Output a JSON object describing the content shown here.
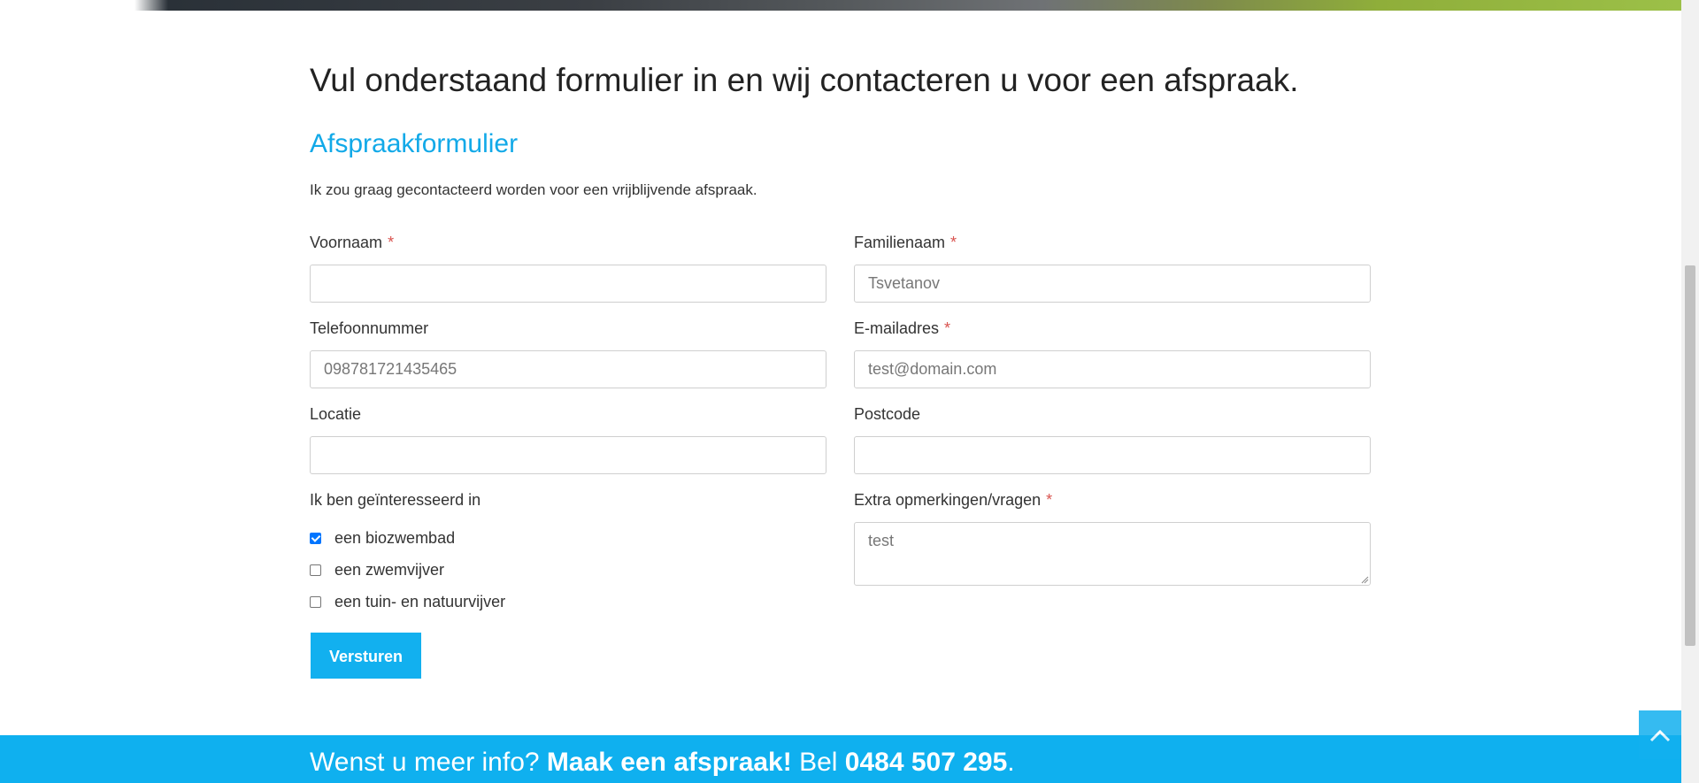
{
  "lead": "Vul onderstaand formulier in en wij contacteren u voor een afspraak.",
  "form": {
    "title": "Afspraakformulier",
    "intro": "Ik zou graag gecontacteerd worden voor een vrijblijvende afspraak.",
    "required_marker": "*",
    "fields": {
      "voornaam": {
        "label": "Voornaam",
        "value": ""
      },
      "familienaam": {
        "label": "Familienaam",
        "value": "Tsvetanov"
      },
      "telefoon": {
        "label": "Telefoonnummer",
        "value": "098781721435465"
      },
      "email": {
        "label": "E-mailadres",
        "value": "test@domain.com"
      },
      "locatie": {
        "label": "Locatie",
        "value": ""
      },
      "postcode": {
        "label": "Postcode",
        "value": ""
      },
      "opmerkingen": {
        "label": "Extra opmerkingen/vragen",
        "value": "test"
      }
    },
    "interest": {
      "label": "Ik ben geïnteresseerd in",
      "options": [
        {
          "label": "een biozwembad",
          "checked": true
        },
        {
          "label": "een zwemvijver",
          "checked": false
        },
        {
          "label": "een tuin- en natuurvijver",
          "checked": false
        }
      ]
    },
    "submit_label": "Versturen"
  },
  "cta": {
    "prefix": "Wenst u meer info?",
    "strong": "Maak een afspraak!",
    "middle": "Bel",
    "phone": "0484 507 295",
    "suffix": "."
  },
  "icons": {
    "back_to_top": "chevron-up-icon"
  },
  "colors": {
    "accent": "#12b0ef",
    "required": "#d9534f"
  }
}
